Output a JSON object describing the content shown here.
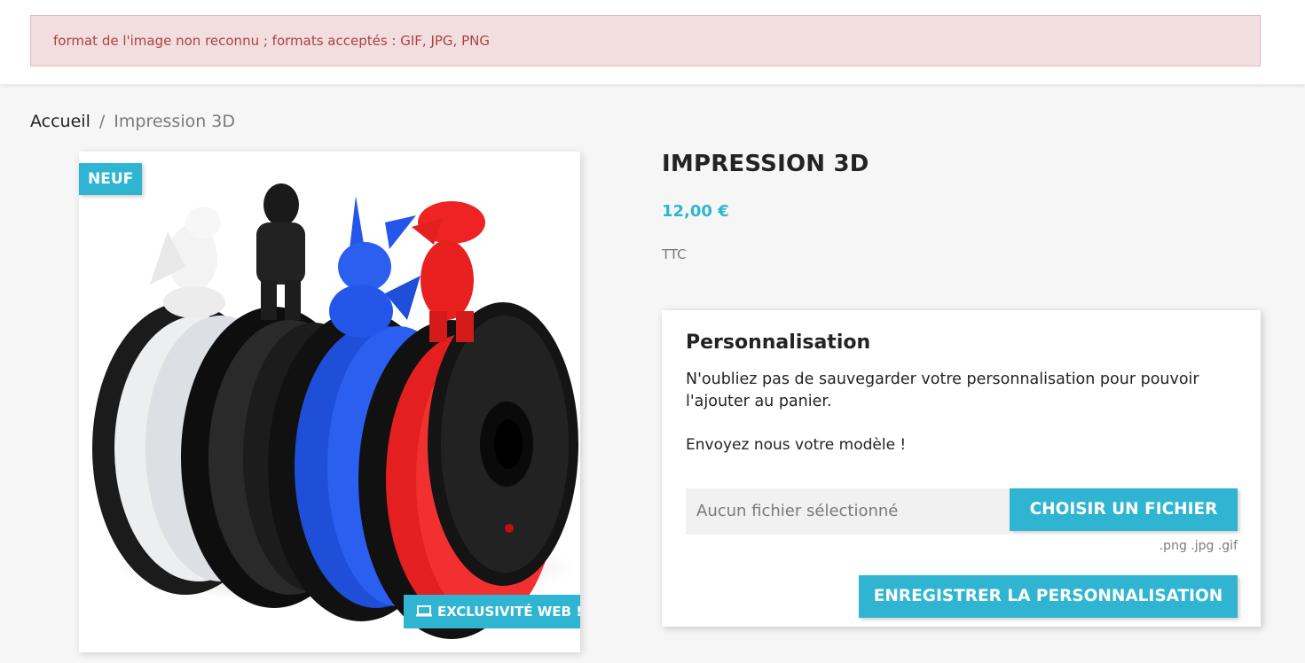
{
  "alert": {
    "message": "format de l'image non reconnu ; formats acceptés : GIF, JPG, PNG"
  },
  "breadcrumb": {
    "home": "Accueil",
    "separator": "/",
    "current": "Impression 3D"
  },
  "product": {
    "flag_new": "NEUF",
    "flag_web": "EXCLUSIVITÉ WEB !",
    "title": "IMPRESSION 3D",
    "price": "12,00 €",
    "tax_label": "TTC"
  },
  "customization": {
    "heading": "Personnalisation",
    "note": "N'oubliez pas de sauvegarder votre personnalisation pour pouvoir l'ajouter au panier.",
    "field_label": "Envoyez nous votre modèle !",
    "file_placeholder": "Aucun fichier sélectionné",
    "choose_button": "CHOISIR UN FICHIER",
    "accepted_types": ".png .jpg .gif",
    "save_button": "ENREGISTRER LA PERSONNALISATION"
  },
  "colors": {
    "accent": "#2fb5d2",
    "alert_bg": "#f2dede",
    "alert_text": "#a94442",
    "spool_white": "#e8e8ea",
    "spool_black": "#1b1b1b",
    "spool_blue": "#1f4fd8",
    "spool_red": "#e41f1f"
  }
}
